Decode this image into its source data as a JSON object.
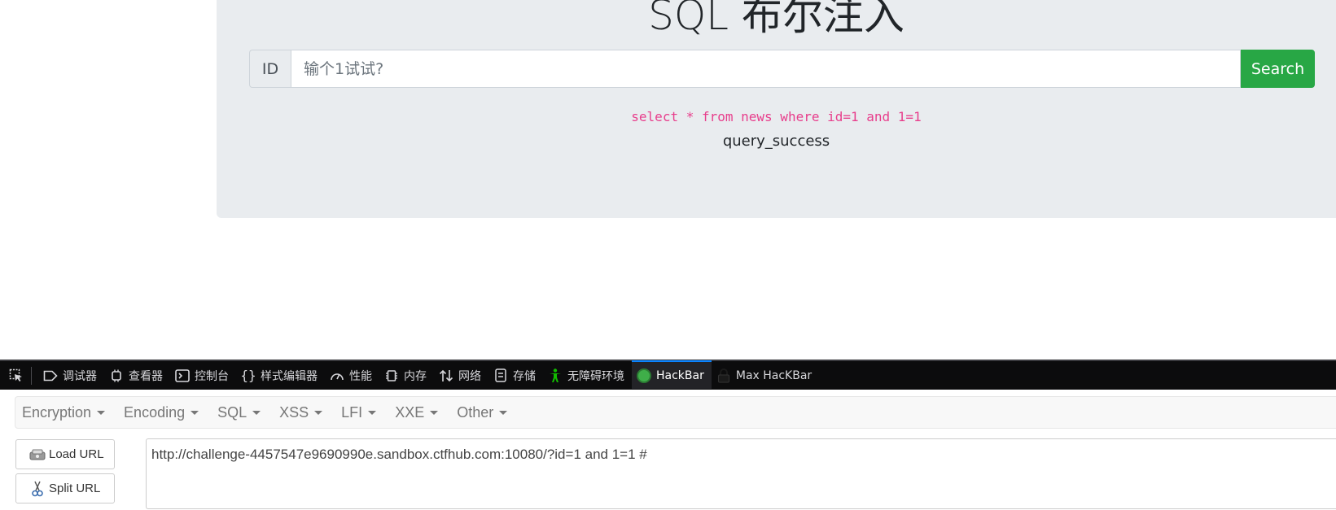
{
  "page": {
    "title": "SQL 布尔注入",
    "search": {
      "id_label": "ID",
      "placeholder": "输个1试试?",
      "value": "",
      "button_label": "Search"
    },
    "sql_query": "select * from news where id=1 and 1=1",
    "result_text": "query_success"
  },
  "devtools": {
    "tabs": [
      {
        "label": "调试器",
        "icon": "debugger-icon"
      },
      {
        "label": "查看器",
        "icon": "inspector-icon"
      },
      {
        "label": "控制台",
        "icon": "console-icon"
      },
      {
        "label": "样式编辑器",
        "icon": "style-editor-icon"
      },
      {
        "label": "性能",
        "icon": "performance-icon"
      },
      {
        "label": "内存",
        "icon": "memory-icon"
      },
      {
        "label": "网络",
        "icon": "network-icon"
      },
      {
        "label": "存储",
        "icon": "storage-icon"
      },
      {
        "label": "无障碍环境",
        "icon": "accessibility-icon"
      },
      {
        "label": "HackBar",
        "icon": "hackbar-icon",
        "active": true
      },
      {
        "label": "Max HacKBar",
        "icon": "lock-icon"
      }
    ]
  },
  "hackbar": {
    "menu": [
      "Encryption",
      "Encoding",
      "SQL",
      "XSS",
      "LFI",
      "XXE",
      "Other"
    ],
    "load_url_label": "Load URL",
    "split_url_label": "Split URL",
    "url_value": "http://challenge-4457547e9690990e.sandbox.ctfhub.com:10080/?id=1 and 1=1 #"
  },
  "colors": {
    "accent_green": "#28a745",
    "sql_pink": "#e83e8c",
    "devtools_bg": "#0c0c0d",
    "active_tab_border": "#0a84ff"
  }
}
